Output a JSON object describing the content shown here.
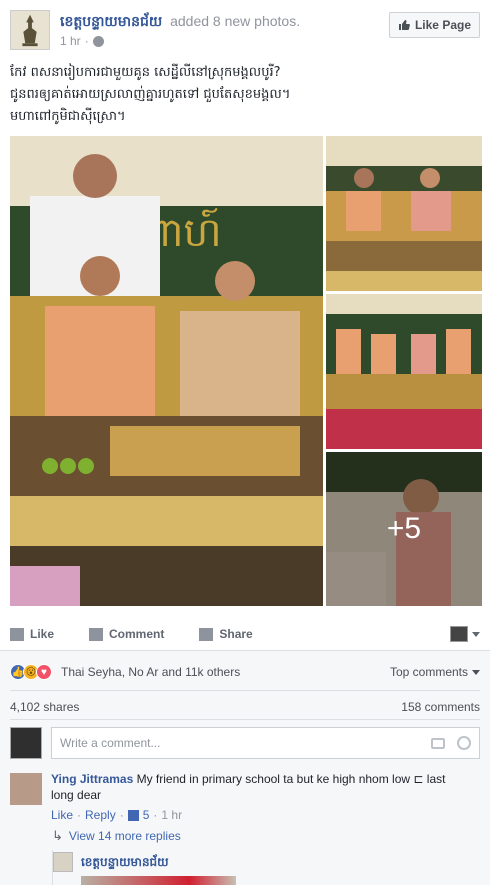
{
  "post": {
    "page_name": "ខេត្តបន្ទាយមានជ័យ",
    "action_text": "added 8 new photos.",
    "time": "1 hr",
    "like_page_label": "Like Page",
    "text_lines": [
      "កែវ ពសនារៀបការជាមួយគូន សេដ្ឋីលីនៅស្រុកមង្គលបូរី?",
      "ជូនពរឲ្យគាត់អោយស្រលាញ់គ្នារហូតទៅ ជួបតែសុខមង្គល។",
      "មហាពៅកូមិជាស៊ីស្រោ។"
    ],
    "more_photos": "+5"
  },
  "actions": {
    "like": "Like",
    "comment": "Comment",
    "share": "Share"
  },
  "reactions": {
    "summary": "Thai Seyha, No Ar and 11k others",
    "top_comments": "Top comments",
    "shares": "4,102 shares",
    "comments_count": "158 comments"
  },
  "composer": {
    "placeholder": "Write a comment..."
  },
  "comment": {
    "author": "Ying Jittramas",
    "text": "My friend in primary school ta but ke high nhom low ⊏ last long dear",
    "like": "Like",
    "reply": "Reply",
    "likes": "5",
    "time": "1 hr"
  },
  "replies": {
    "view_more": "View 14 more replies",
    "reply_author": "ខេត្តបន្ទាយមានជ័យ"
  },
  "colors": {
    "link_blue": "#365899",
    "like_blue": "#4267b2",
    "love_red": "#f25268",
    "wow_yellow": "#f7b125"
  }
}
